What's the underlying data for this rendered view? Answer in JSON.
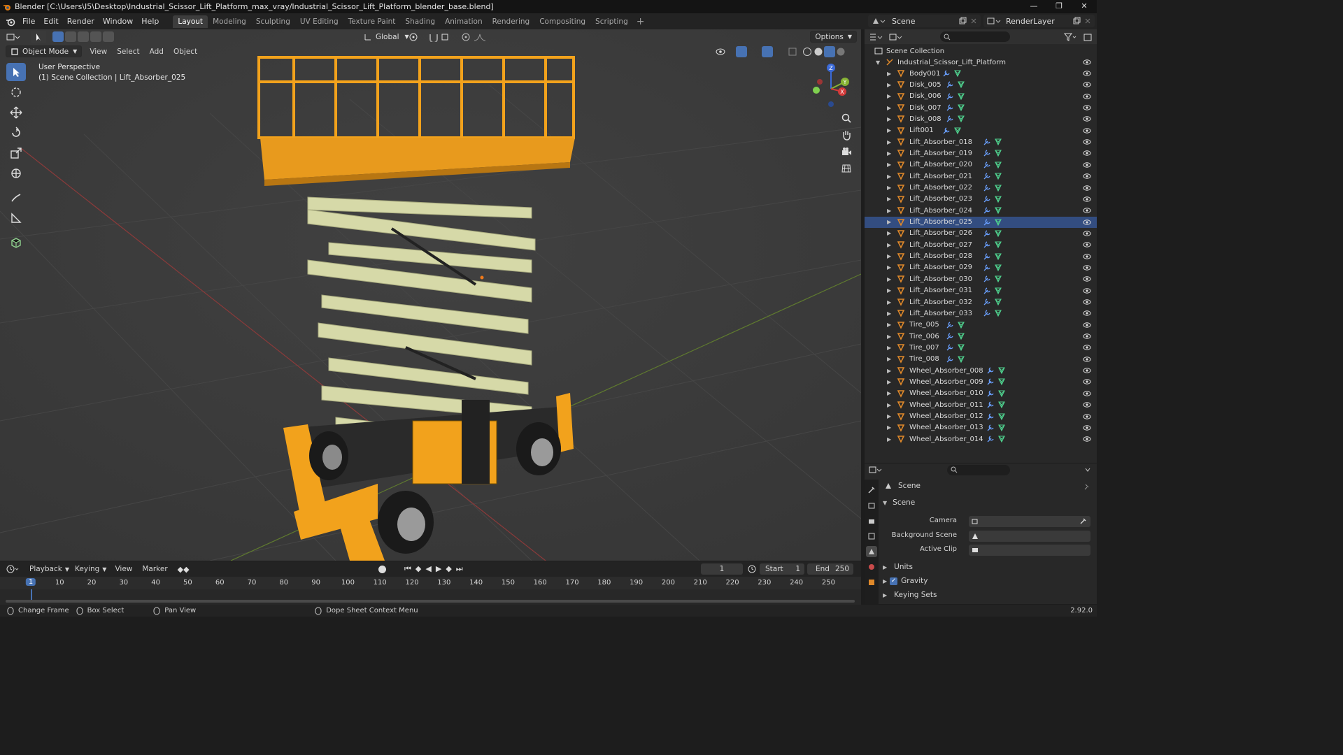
{
  "window": {
    "title": "Blender [C:\\Users\\I5\\Desktop\\Industrial_Scissor_Lift_Platform_max_vray/Industrial_Scissor_Lift_Platform_blender_base.blend]",
    "minimize": "—",
    "restore": "❐",
    "close": "✕"
  },
  "menubar": {
    "items": [
      "File",
      "Edit",
      "Render",
      "Window",
      "Help"
    ]
  },
  "workspaces": {
    "tabs": [
      "Layout",
      "Modeling",
      "Sculpting",
      "UV Editing",
      "Texture Paint",
      "Shading",
      "Animation",
      "Rendering",
      "Compositing",
      "Scripting"
    ],
    "active": "Layout",
    "add": "+"
  },
  "scene_selector": {
    "value": "Scene"
  },
  "view_layer_selector": {
    "value": "RenderLayer"
  },
  "viewport": {
    "mode": "Object Mode",
    "menus": [
      "View",
      "Select",
      "Add",
      "Object"
    ],
    "transform_orientation": "Global",
    "options_label": "Options",
    "perspective_label": "User Perspective",
    "collection_label": "(1) Scene Collection | Lift_Absorber_025",
    "axis_x": "X",
    "axis_y": "Y",
    "axis_z": "Z"
  },
  "outliner": {
    "root": "Scene Collection",
    "collection": "Industrial_Scissor_Lift_Platform",
    "objects": [
      "Body001",
      "Disk_005",
      "Disk_006",
      "Disk_007",
      "Disk_008",
      "Lift001",
      "Lift_Absorber_018",
      "Lift_Absorber_019",
      "Lift_Absorber_020",
      "Lift_Absorber_021",
      "Lift_Absorber_022",
      "Lift_Absorber_023",
      "Lift_Absorber_024",
      "Lift_Absorber_025",
      "Lift_Absorber_026",
      "Lift_Absorber_027",
      "Lift_Absorber_028",
      "Lift_Absorber_029",
      "Lift_Absorber_030",
      "Lift_Absorber_031",
      "Lift_Absorber_032",
      "Lift_Absorber_033",
      "Tire_005",
      "Tire_006",
      "Tire_007",
      "Tire_008",
      "Wheel_Absorber_008",
      "Wheel_Absorber_009",
      "Wheel_Absorber_010",
      "Wheel_Absorber_011",
      "Wheel_Absorber_012",
      "Wheel_Absorber_013",
      "Wheel_Absorber_014"
    ],
    "selected": "Lift_Absorber_025"
  },
  "properties": {
    "context": "Scene",
    "panel": "Scene",
    "camera_label": "Camera",
    "background_scene_label": "Background Scene",
    "active_clip_label": "Active Clip",
    "sections": [
      "Units",
      "Gravity",
      "Keying Sets"
    ],
    "gravity_checked": true
  },
  "timeline": {
    "menus": [
      "Playback",
      "Keying",
      "View",
      "Marker"
    ],
    "current_frame": "1",
    "start_label": "Start",
    "start_value": "1",
    "end_label": "End",
    "end_value": "250",
    "ticks": [
      "1",
      "10",
      "20",
      "30",
      "40",
      "50",
      "60",
      "70",
      "80",
      "90",
      "100",
      "110",
      "120",
      "130",
      "140",
      "150",
      "160",
      "170",
      "180",
      "190",
      "200",
      "210",
      "220",
      "230",
      "240",
      "250"
    ]
  },
  "statusbar": {
    "items": [
      "Change Frame",
      "Box Select",
      "Pan View",
      "Dope Sheet Context Menu"
    ],
    "version": "2.92.0"
  },
  "colors": {
    "accent": "#4772b3",
    "lift_yellow": "#f2a21c",
    "scissor_cream": "#d6d9a8",
    "mesh_icon": "#e0892a",
    "vertex_icon": "#4fd18e",
    "modifier_icon": "#6aa0ff"
  }
}
